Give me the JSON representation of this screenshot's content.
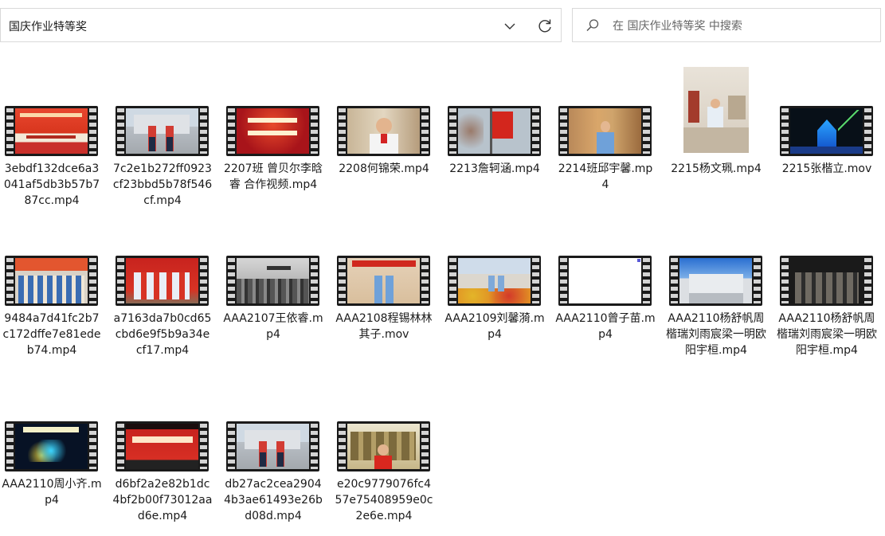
{
  "address_bar": {
    "path": "国庆作业特等奖"
  },
  "search": {
    "placeholder": "在 国庆作业特等奖 中搜索"
  },
  "files": [
    {
      "name": "3ebdf132dce6a3041af5db3b57b787cc.mp4",
      "thumb": "banner-red"
    },
    {
      "name": "7c2e1b272ff0923cf23bbd5b78f546cf.mp4",
      "thumb": "building-duo"
    },
    {
      "name": "2207班 曾贝尔李晗睿 合作视频.mp4",
      "thumb": "red-text"
    },
    {
      "name": "2208何锦荣.mp4",
      "thumb": "boy-indoor"
    },
    {
      "name": "2213詹轲涵.mp4",
      "thumb": "flag-tree"
    },
    {
      "name": "2214班邱宇馨.mp4",
      "thumb": "girl-door"
    },
    {
      "name": "2215杨文珮.mp4",
      "thumb": "portrait-museum"
    },
    {
      "name": "2215张楷立.mov",
      "thumb": "night-blue"
    },
    {
      "name": "9484a7d41fc2b7c172dffe7e81edeb74.mp4",
      "thumb": "group-banner"
    },
    {
      "name": "a7163da7b0cd65cbd6e9f5b9a34ecf17.mp4",
      "thumb": "group-red"
    },
    {
      "name": "AAA2107王依睿.mp4",
      "thumb": "bw-city"
    },
    {
      "name": "AAA2108程锡林林其子.mov",
      "thumb": "duo-banner"
    },
    {
      "name": "AAA2109刘馨漪.mp4",
      "thumb": "flowers-duo"
    },
    {
      "name": "AAA2110曾子苗.mp4",
      "thumb": "white"
    },
    {
      "name": "AAA2110杨舒帆周楷瑞刘雨宸梁一明欧阳宇桓.mp4",
      "thumb": "building-blue"
    },
    {
      "name": "AAA2110杨舒帆周楷瑞刘雨宸梁一明欧阳宇桓.mp4",
      "thumb": "dark-group"
    },
    {
      "name": "AAA2110周小齐.mp4",
      "thumb": "neon"
    },
    {
      "name": "d6bf2a2e82b1dc4bf2b00f73012aad6e.mp4",
      "thumb": "red-banner2"
    },
    {
      "name": "db27ac2cea29044b3ae61493e26bd08d.mp4",
      "thumb": "building-duo"
    },
    {
      "name": "e20c9779076fc457e75408959e0c2e6e.mp4",
      "thumb": "statue-boy"
    }
  ]
}
